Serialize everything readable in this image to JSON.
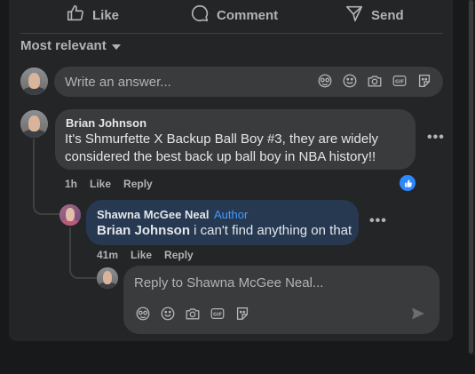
{
  "actions": {
    "like_label": "Like",
    "comment_label": "Comment",
    "send_label": "Send"
  },
  "sort": {
    "label": "Most relevant"
  },
  "composer": {
    "placeholder": "Write an answer...",
    "icons": [
      "avatar-sticker-icon",
      "emoji-icon",
      "camera-icon",
      "gif-icon",
      "sticker-icon"
    ]
  },
  "comments": [
    {
      "author": "Brian Johnson",
      "text": "It's Shmurfette X Backup Ball Boy #3, they are widely considered the best back up ball boy in NBA history!!",
      "time": "1h",
      "like_label": "Like",
      "reply_label": "Reply",
      "reaction": "like-reaction-icon",
      "replies": [
        {
          "author": "Shawna McGee Neal",
          "badge": "Author",
          "mention": "Brian Johnson",
          "text": " i can't find anything on that",
          "time": "41m",
          "like_label": "Like",
          "reply_label": "Reply"
        }
      ]
    }
  ],
  "reply_composer": {
    "placeholder": "Reply to Shawna McGee Neal...",
    "icons": [
      "avatar-sticker-icon",
      "emoji-icon",
      "camera-icon",
      "gif-icon",
      "sticker-icon"
    ],
    "send_icon": "send-arrow-icon"
  },
  "colors": {
    "background": "#18191a",
    "card": "#242526",
    "bubble": "#3a3b3c",
    "author_bubble": "#263951",
    "author_badge": "#4599ff",
    "like_blue": "#2d88ff",
    "secondary_text": "#b0b3b8"
  }
}
